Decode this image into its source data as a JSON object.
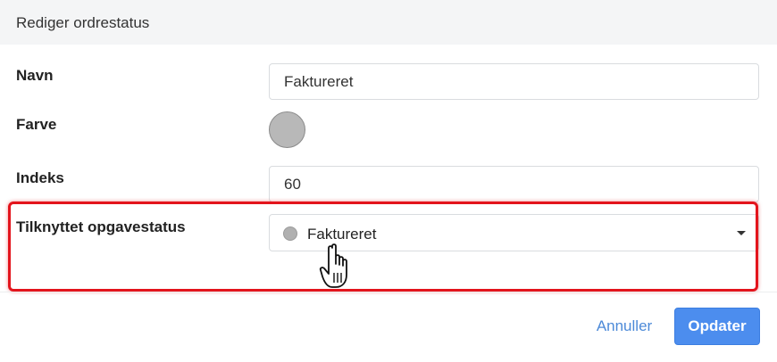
{
  "dialog": {
    "title": "Rediger ordrestatus"
  },
  "form": {
    "name": {
      "label": "Navn",
      "value": "Faktureret"
    },
    "color": {
      "label": "Farve",
      "value": "#b8b8b8"
    },
    "index": {
      "label": "Indeks",
      "value": "60"
    },
    "linked_status": {
      "label": "Tilknyttet opgavestatus",
      "selected": "Faktureret",
      "selected_color": "#b0b0b0"
    }
  },
  "actions": {
    "cancel_label": "Annuller",
    "update_label": "Opdater"
  },
  "colors": {
    "accent": "#4c8dee",
    "highlight": "#e3141c",
    "link": "#4d8ad8"
  },
  "icons": {
    "cursor": "hand-pointer-icon",
    "caret": "caret-down-icon"
  }
}
